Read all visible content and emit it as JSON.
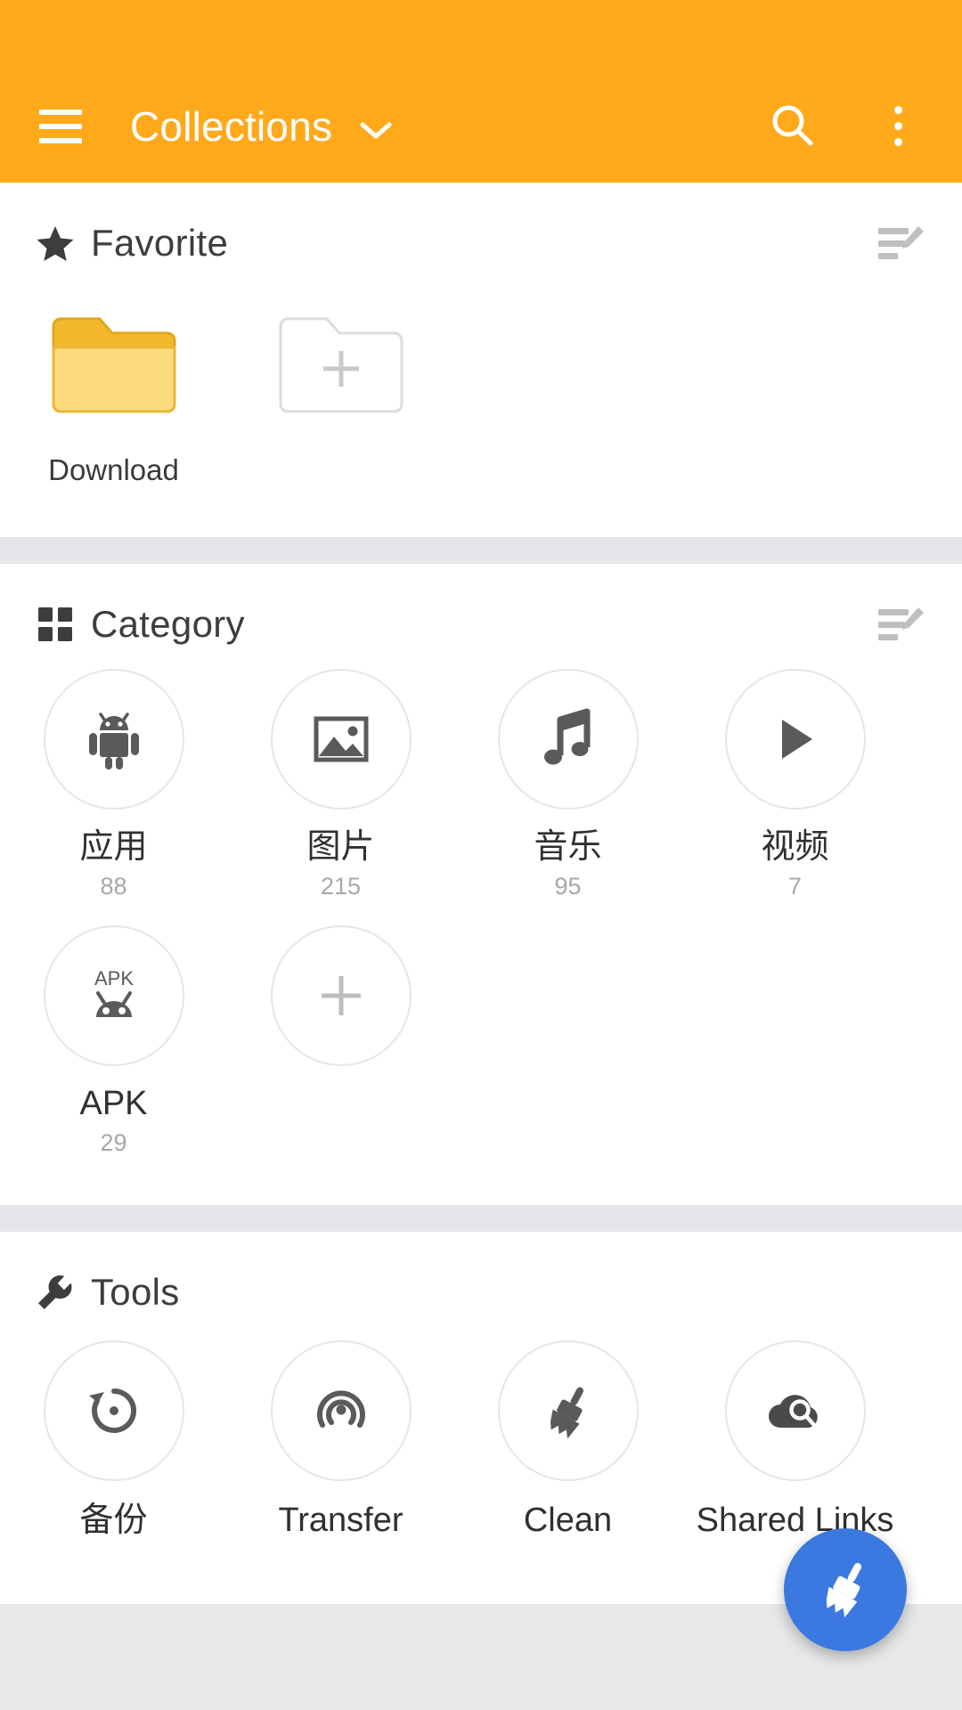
{
  "toolbar": {
    "menu_icon": "hamburger-menu-icon",
    "title": "Collections",
    "dropdown_icon": "chevron-down-icon",
    "search_icon": "search-icon",
    "overflow_icon": "more-vertical-icon",
    "background_color": "#FFA91B"
  },
  "favorite": {
    "icon": "star-icon",
    "title": "Favorite",
    "edit_icon": "edit-list-icon",
    "items": [
      {
        "label": "Download",
        "icon": "folder-icon"
      }
    ],
    "add": {
      "label": "",
      "icon": "add-folder-icon"
    }
  },
  "category": {
    "icon": "grid-icon",
    "title": "Category",
    "edit_icon": "edit-list-icon",
    "items": [
      {
        "label": "应用",
        "count": "88",
        "icon": "android-robot-icon"
      },
      {
        "label": "图片",
        "count": "215",
        "icon": "image-icon"
      },
      {
        "label": "音乐",
        "count": "95",
        "icon": "music-note-icon"
      },
      {
        "label": "视频",
        "count": "7",
        "icon": "play-triangle-icon"
      },
      {
        "label": "APK",
        "count": "29",
        "icon": "apk-icon"
      }
    ],
    "add": {
      "icon": "plus-icon"
    }
  },
  "tools": {
    "icon": "wrench-icon",
    "title": "Tools",
    "items": [
      {
        "label": "备份",
        "icon": "restore-backup-icon"
      },
      {
        "label": "Transfer",
        "icon": "broadcast-icon"
      },
      {
        "label": "Clean",
        "icon": "broom-icon"
      },
      {
        "label": "Shared Links",
        "icon": "cloud-search-icon"
      }
    ]
  },
  "fab": {
    "icon": "broom-icon",
    "color": "#3b79e0"
  }
}
